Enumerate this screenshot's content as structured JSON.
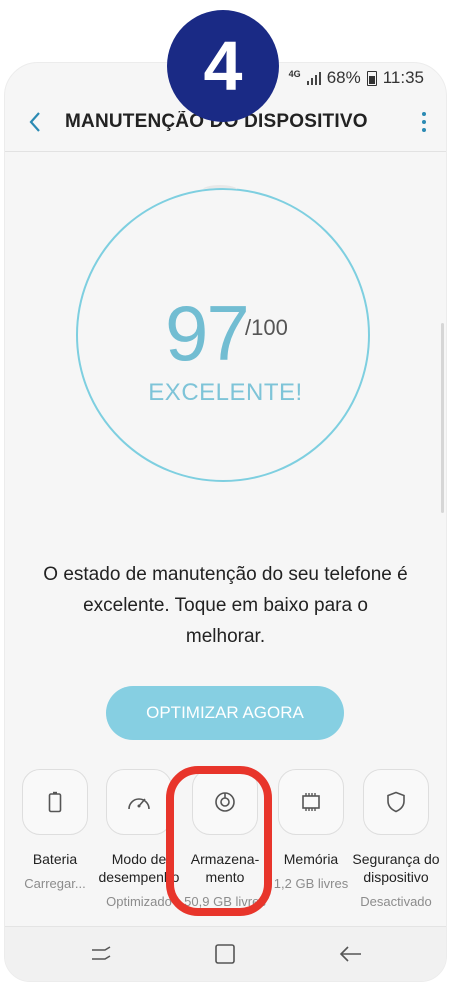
{
  "status_bar": {
    "network": "4G",
    "battery_level": "68%",
    "time": "11:35"
  },
  "header": {
    "title": "MANUTENÇÃO DO DISPOSITIVO",
    "back_icon": "chevron-left-icon",
    "menu_icon": "more-vertical-icon"
  },
  "score": {
    "value": "97",
    "max": "/100",
    "rating": "EXCELENTE!",
    "ring_color": "#7ecfe0"
  },
  "message": "O estado de manutenção do seu telefone é excelente. Toque em baixo para o melhorar.",
  "optimize_button": {
    "label": "OPTIMIZAR AGORA",
    "color": "#86cfe2"
  },
  "tools": [
    {
      "label": "Bateria",
      "status": "Carregar...",
      "icon": "battery-icon"
    },
    {
      "label": "Modo de desempenho",
      "status": "Optimizado",
      "icon": "gauge-icon"
    },
    {
      "label": "Armazena-\nmento",
      "status": "50,9 GB livres",
      "icon": "storage-icon"
    },
    {
      "label": "Memória",
      "status": "1,2 GB livres",
      "icon": "memory-chip-icon"
    },
    {
      "label": "Segurança do dispositivo",
      "status": "Desactivado",
      "icon": "shield-icon"
    }
  ],
  "nav_bar": {
    "recent_icon": "recent-apps-icon",
    "home_icon": "home-icon",
    "back_icon": "back-arrow-icon"
  },
  "step_badge": {
    "number": "4",
    "color": "#1a2a85"
  },
  "highlight_color": "#e8352b"
}
